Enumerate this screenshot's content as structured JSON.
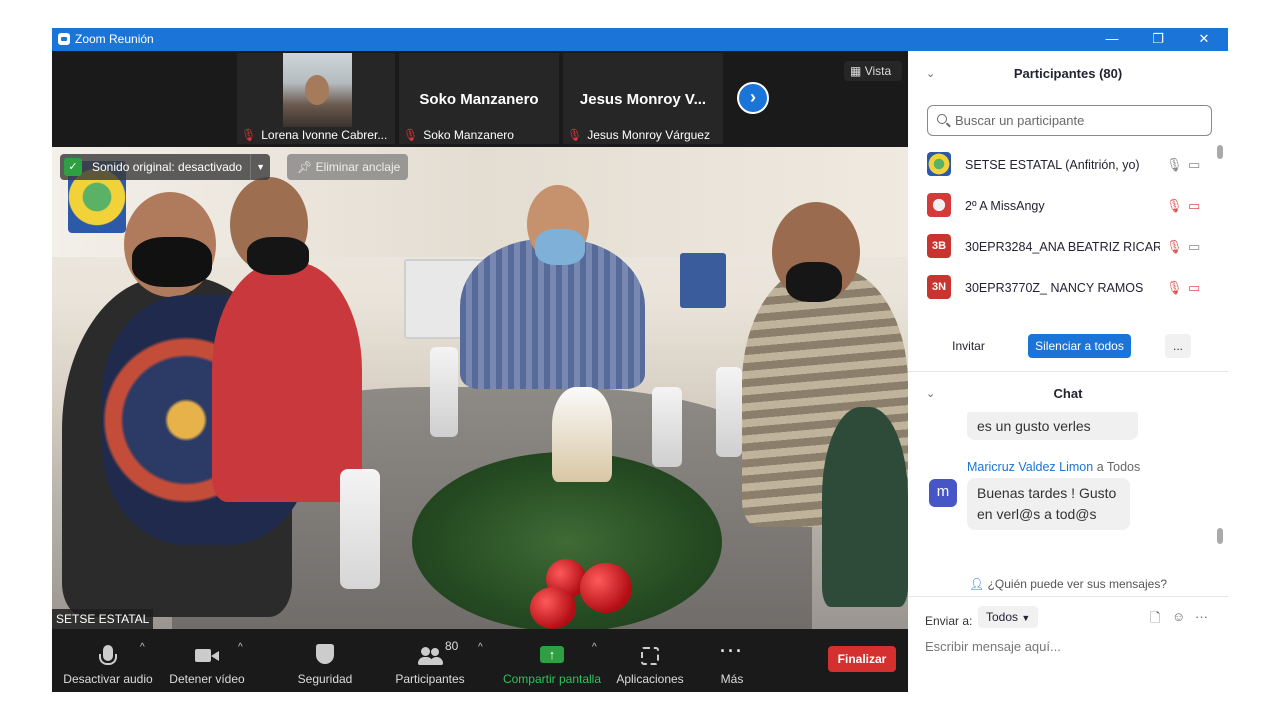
{
  "window": {
    "title": "Zoom Reunión",
    "minimize": "—",
    "restore": "❐",
    "close": "✕"
  },
  "thumbnails": [
    {
      "label": "Lorena Ivonne Cabrer...",
      "has_video": true
    },
    {
      "name_big": "Soko Manzanero",
      "label": "Soko Manzanero"
    },
    {
      "name_big": "Jesus Monroy V...",
      "label": "Jesus Monroy Várguez"
    }
  ],
  "view_button": "Vista",
  "main_video": {
    "original_sound": "Sonido original: desactivado",
    "unpin": "Eliminar anclaje",
    "speaker_name": "SETSE ESTATAL"
  },
  "toolbar": {
    "mute": "Desactivar audio",
    "video": "Detener vídeo",
    "security": "Seguridad",
    "participants": "Participantes",
    "participants_count": "80",
    "share": "Compartir pantalla",
    "apps": "Aplicaciones",
    "more": "Más",
    "end": "Finalizar"
  },
  "participants_panel": {
    "title": "Participantes (80)",
    "search_placeholder": "Buscar un participante",
    "rows": [
      {
        "name": "SETSE ESTATAL (Anfitrión, yo)",
        "avatar": "",
        "mic": "on",
        "video": "on"
      },
      {
        "name": "2º A  MissAngy",
        "avatar": "",
        "mic": "muted",
        "video": "off"
      },
      {
        "name": "30EPR3284_ANA BEATRIZ RICAR...",
        "avatar": "3B",
        "mic": "muted",
        "video": "on"
      },
      {
        "name": "30EPR3770Z_ NANCY RAMOS",
        "avatar": "3N",
        "mic": "muted",
        "video": "off"
      }
    ],
    "invite": "Invitar",
    "mute_all": "Silenciar a todos",
    "more": "..."
  },
  "chat": {
    "title": "Chat",
    "messages": [
      {
        "text": "es un gusto verles"
      },
      {
        "sender": "Maricruz Valdez Limon",
        "to": "a Todos",
        "avatar": "m",
        "line1": "Buenas tardes ! Gusto",
        "line2": "en verl@s a tod@s"
      }
    ],
    "who_can_see": "¿Quién puede ver sus mensajes?",
    "send_to_label": "Enviar a:",
    "send_to_value": "Todos",
    "compose_placeholder": "Escribir mensaje aquí..."
  },
  "colors": {
    "zoom_blue": "#1b74d8",
    "end_red": "#d3302f",
    "share_green": "#2ea043",
    "avatar_red": "#c9342f",
    "avatar_purple": "#4756c7"
  }
}
